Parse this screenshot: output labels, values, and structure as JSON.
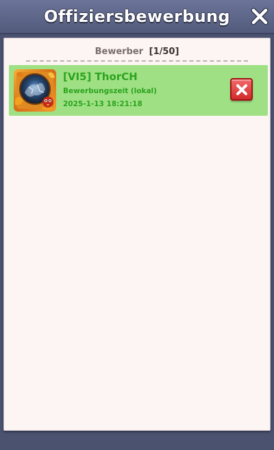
{
  "header": {
    "title": "Offiziersbewerbung",
    "close_icon": "close-icon"
  },
  "applicants": {
    "label": "Bewerber",
    "count": "[1/50]"
  },
  "list": [
    {
      "name": "[VI5] ThorCH",
      "time_label": "Bewerbungszeit (lokal)",
      "timestamp": "2025-1-13 18:21:18",
      "avatar_icon": "player-avatar",
      "reject_icon": "reject-x-icon",
      "row_color": "#9fe085",
      "text_color": "#2ca41f"
    }
  ],
  "colors": {
    "background": "#4a5270",
    "titlebar": "#5e6789",
    "panel": "#fdf4f4",
    "reject_button": "#e04444"
  }
}
